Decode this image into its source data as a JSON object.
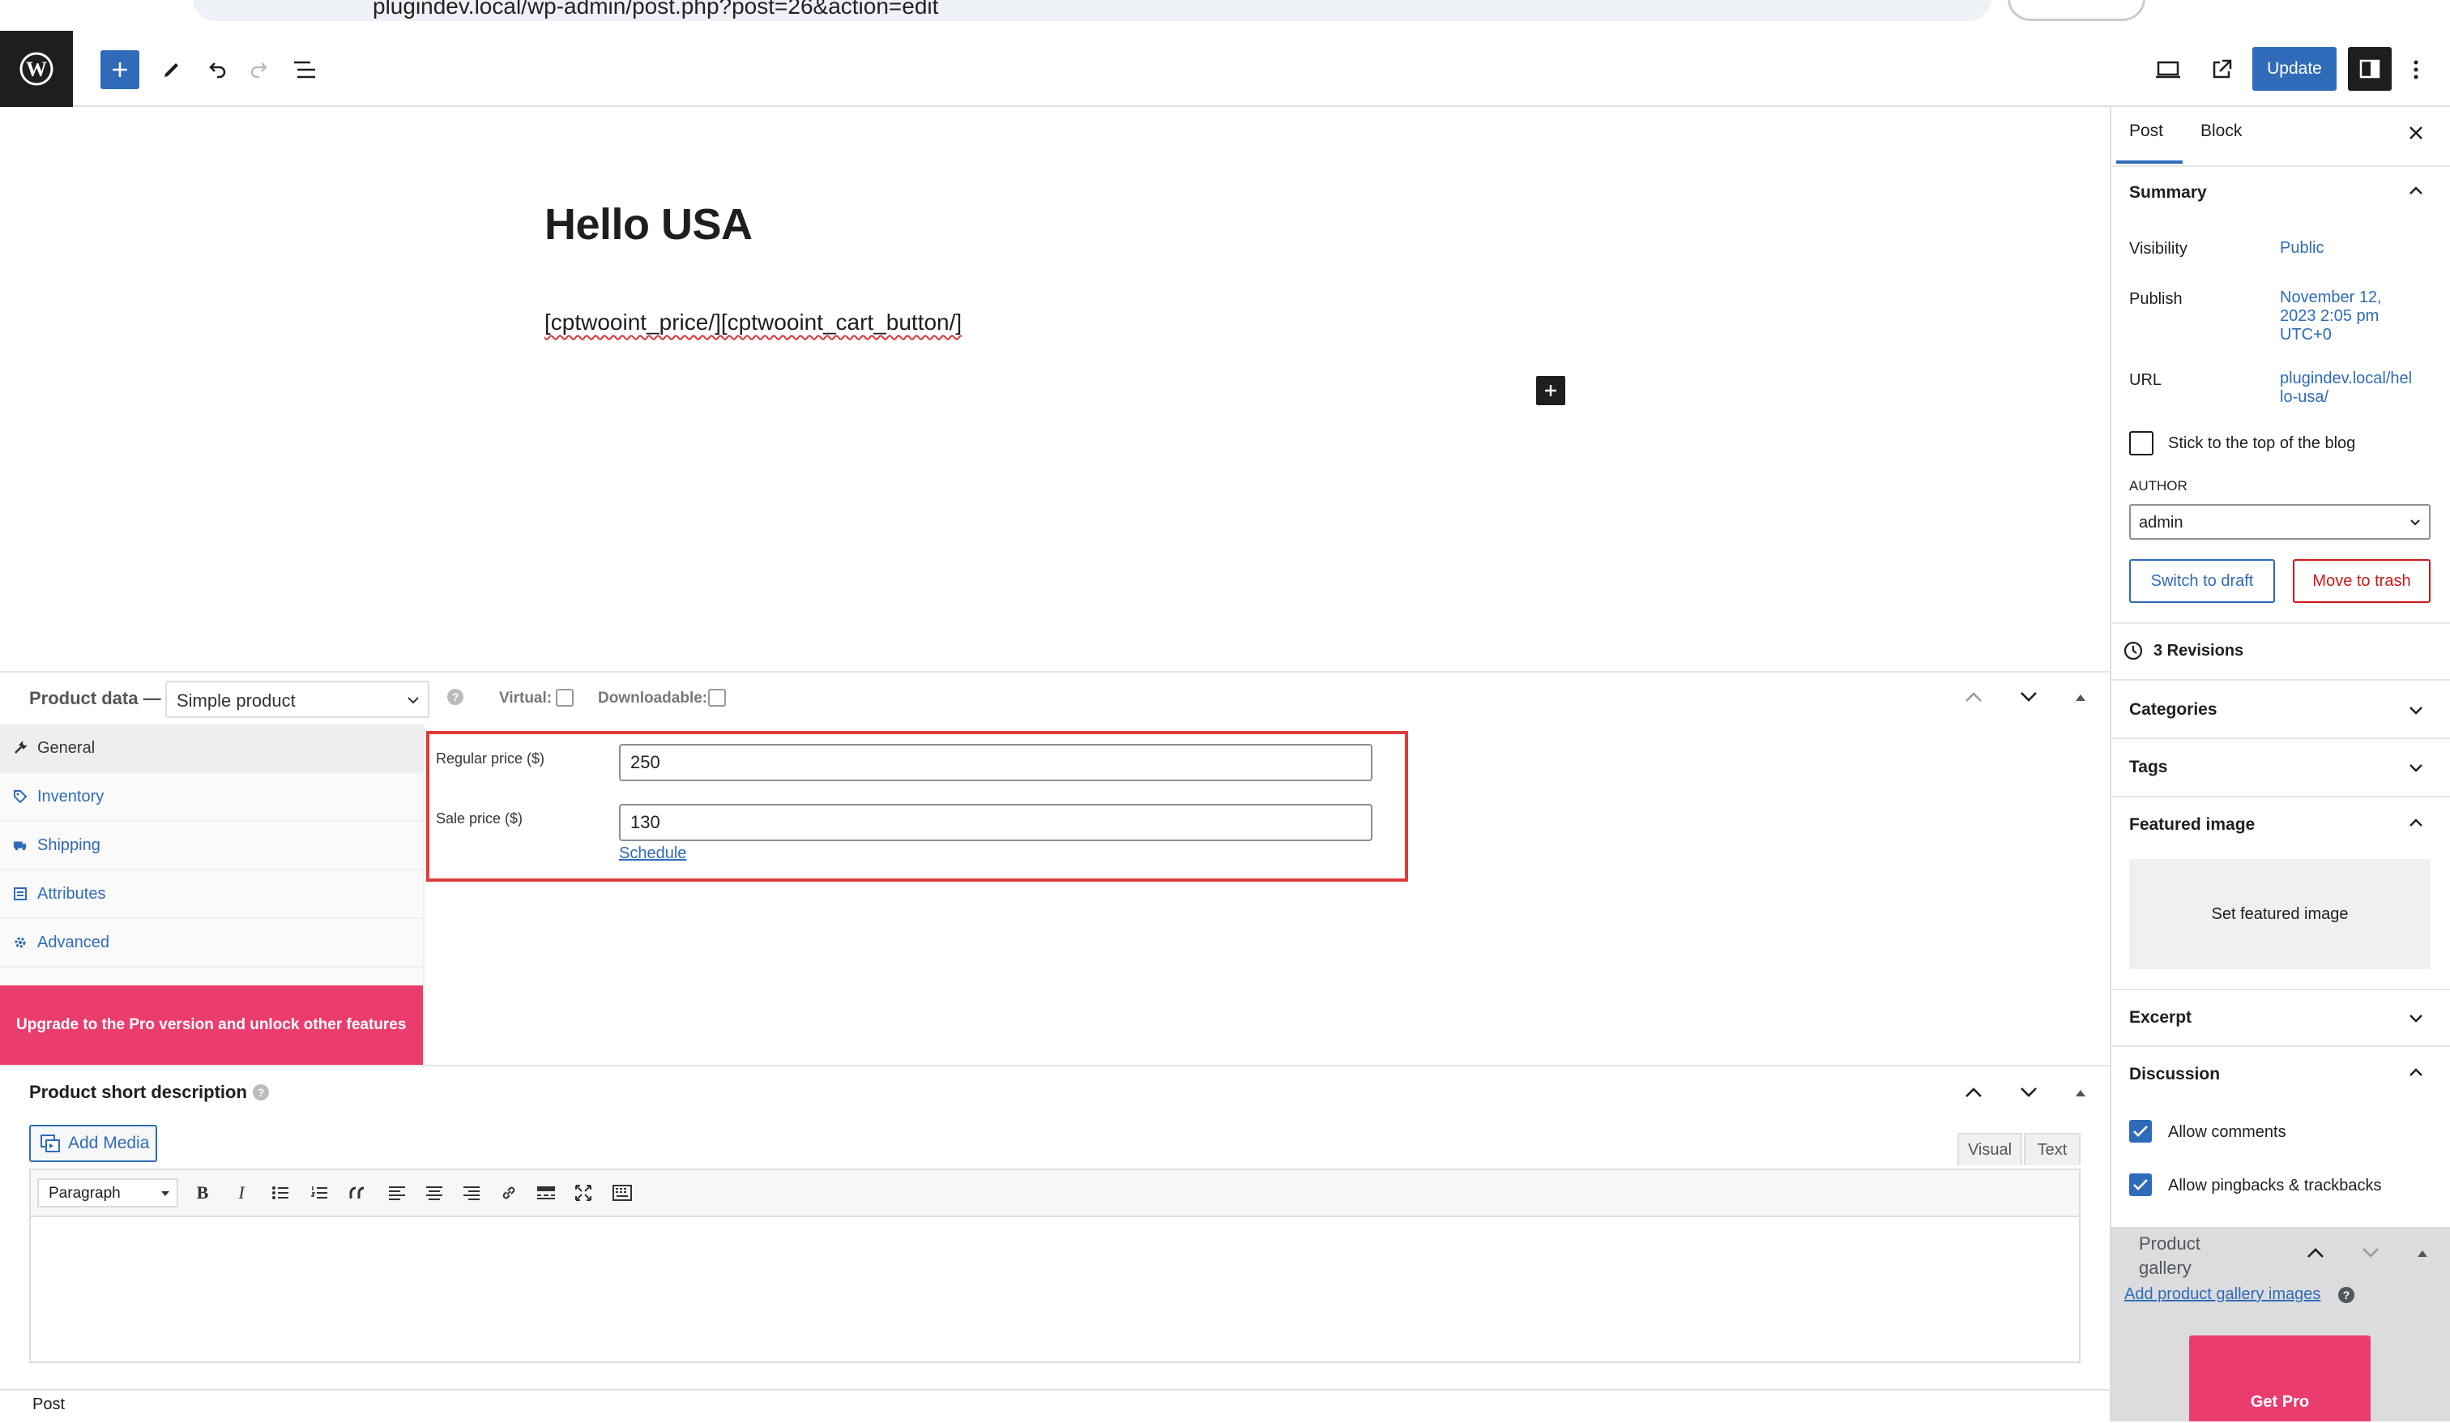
{
  "browser": {
    "url": "plugindev.local/wp-admin/post.php?post=26&action=edit"
  },
  "header": {
    "update_label": "Update"
  },
  "post": {
    "title": "Hello USA",
    "content": "[cptwooint_price/][cptwooint_cart_button/]"
  },
  "product_data": {
    "title": "Product data —",
    "type": "Simple product",
    "virtual_label": "Virtual:",
    "downloadable_label": "Downloadable:",
    "tabs": [
      {
        "label": "General",
        "icon": "wrench-icon"
      },
      {
        "label": "Inventory",
        "icon": "tag-icon"
      },
      {
        "label": "Shipping",
        "icon": "truck-icon"
      },
      {
        "label": "Attributes",
        "icon": "list-icon"
      },
      {
        "label": "Advanced",
        "icon": "gear-icon"
      }
    ],
    "upgrade_banner": "Upgrade to the Pro version and unlock other features",
    "regular_price_label": "Regular price ($)",
    "regular_price": "250",
    "sale_price_label": "Sale price ($)",
    "sale_price": "130",
    "schedule_label": "Schedule"
  },
  "short_description": {
    "title": "Product short description",
    "add_media": "Add Media",
    "tab_visual": "Visual",
    "tab_text": "Text",
    "format": "Paragraph"
  },
  "footer": {
    "breadcrumb": "Post"
  },
  "sidebar": {
    "tab_post": "Post",
    "tab_block": "Block",
    "summary_title": "Summary",
    "visibility_label": "Visibility",
    "visibility_value": "Public",
    "publish_label": "Publish",
    "publish_line1": "November 12,",
    "publish_line2": "2023 2:05 pm",
    "publish_line3": "UTC+0",
    "url_label": "URL",
    "url_line1": "plugindev.local/hel",
    "url_line2": "lo-usa/",
    "sticky_label": "Stick to the top of the blog",
    "author_label": "AUTHOR",
    "author_value": "admin",
    "switch_draft": "Switch to draft",
    "move_trash": "Move to trash",
    "revisions": "3 Revisions",
    "categories": "Categories",
    "tags": "Tags",
    "featured_image": "Featured image",
    "set_featured": "Set featured image",
    "excerpt": "Excerpt",
    "discussion": "Discussion",
    "allow_comments": "Allow comments",
    "allow_pingbacks": "Allow pingbacks & trackbacks",
    "gallery_title_1": "Product",
    "gallery_title_2": "gallery",
    "add_gallery": "Add product gallery images",
    "get_pro": "Get Pro"
  },
  "colors": {
    "accent": "#2f6bb8",
    "pro_pink": "#ea3d6e",
    "highlight": "#e03a3a",
    "dark": "#1e1e1e"
  }
}
